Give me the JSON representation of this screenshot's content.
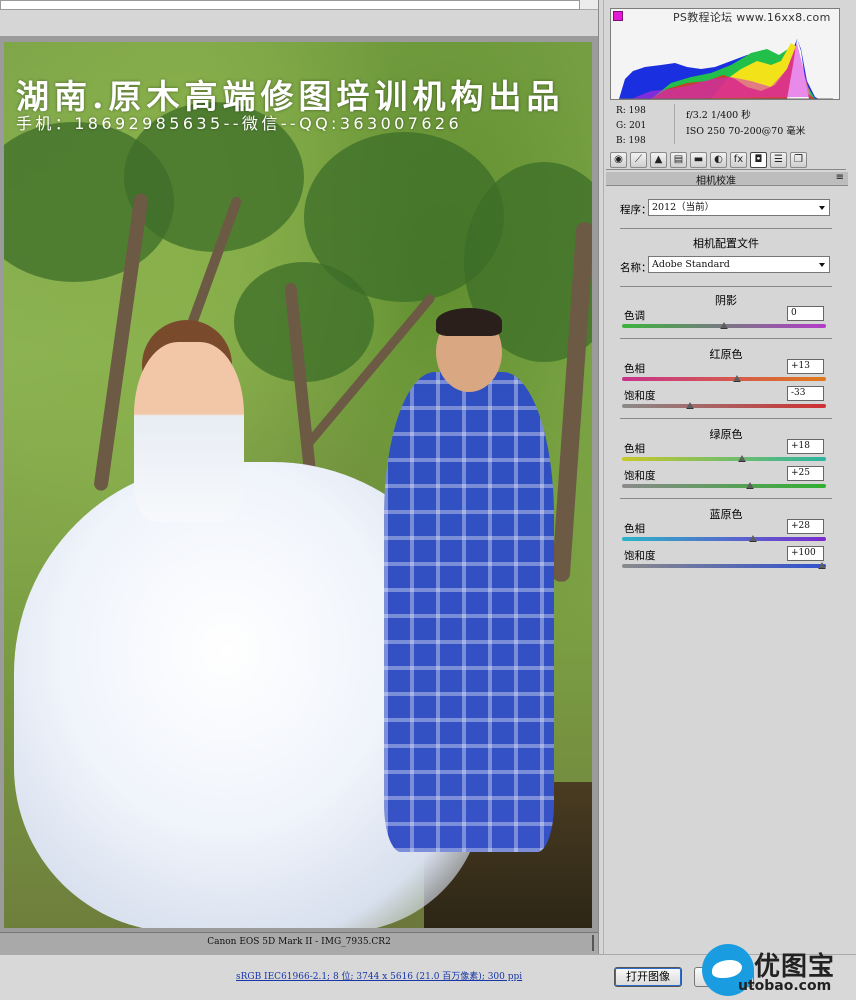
{
  "watermark": {
    "title": "湖南.原木高端修图培训机构出品",
    "contact": "手机：18692985635--微信--QQ:363007626"
  },
  "status": {
    "camera": "Canon EOS 5D Mark II -  IMG_7935.CR2"
  },
  "footer": {
    "info_link": "sRGB IEC61966-2.1; 8 位; 3744 x 5616 (21.0 百万像素); 300 ppi",
    "open_button": "打开图像",
    "brand": "优图宝",
    "brand_domain": "utobao.com"
  },
  "histogram": {
    "site": "PS教程论坛 www.16xx8.com"
  },
  "readout": {
    "r": "R:  198",
    "g": "G:  201",
    "b": "B:  198",
    "aperture_shutter": "f/3.2   1/400 秒",
    "iso_lens": "ISO 250   70-200@70 毫米"
  },
  "tabs": [
    {
      "icon": "aperture-icon",
      "glyph": "◉"
    },
    {
      "icon": "curve-icon",
      "glyph": "⟋"
    },
    {
      "icon": "triangle-icon",
      "glyph": "▲"
    },
    {
      "icon": "hsl-icon",
      "glyph": "▤"
    },
    {
      "icon": "split-tone-icon",
      "glyph": "▬"
    },
    {
      "icon": "lens-icon",
      "glyph": "◐"
    },
    {
      "icon": "fx-icon",
      "glyph": "fx"
    },
    {
      "icon": "camera-icon",
      "glyph": "◘"
    },
    {
      "icon": "sliders-icon",
      "glyph": "☰"
    },
    {
      "icon": "snapshot-icon",
      "glyph": "❐"
    }
  ],
  "section": {
    "title": "相机校准",
    "menu": "≡"
  },
  "process": {
    "label": "程序：",
    "value": "2012（当前）"
  },
  "profile": {
    "heading": "相机配置文件",
    "label": "名称：",
    "value": "Adobe Standard"
  },
  "groups": {
    "shadow": {
      "heading": "阴影",
      "tint_label": "色调",
      "tint_value": "0",
      "tint_pct": 0.5
    },
    "red": {
      "heading": "红原色",
      "hue_label": "色相",
      "hue_value": "+13",
      "hue_pct": 0.565,
      "sat_label": "饱和度",
      "sat_value": "-33",
      "sat_pct": 0.335
    },
    "green": {
      "heading": "绿原色",
      "hue_label": "色相",
      "hue_value": "+18",
      "hue_pct": 0.59,
      "sat_label": "饱和度",
      "sat_value": "+25",
      "sat_pct": 0.625
    },
    "blue": {
      "heading": "蓝原色",
      "hue_label": "色相",
      "hue_value": "+28",
      "hue_pct": 0.64,
      "sat_label": "饱和度",
      "sat_value": "+100",
      "sat_pct": 1.0
    }
  }
}
